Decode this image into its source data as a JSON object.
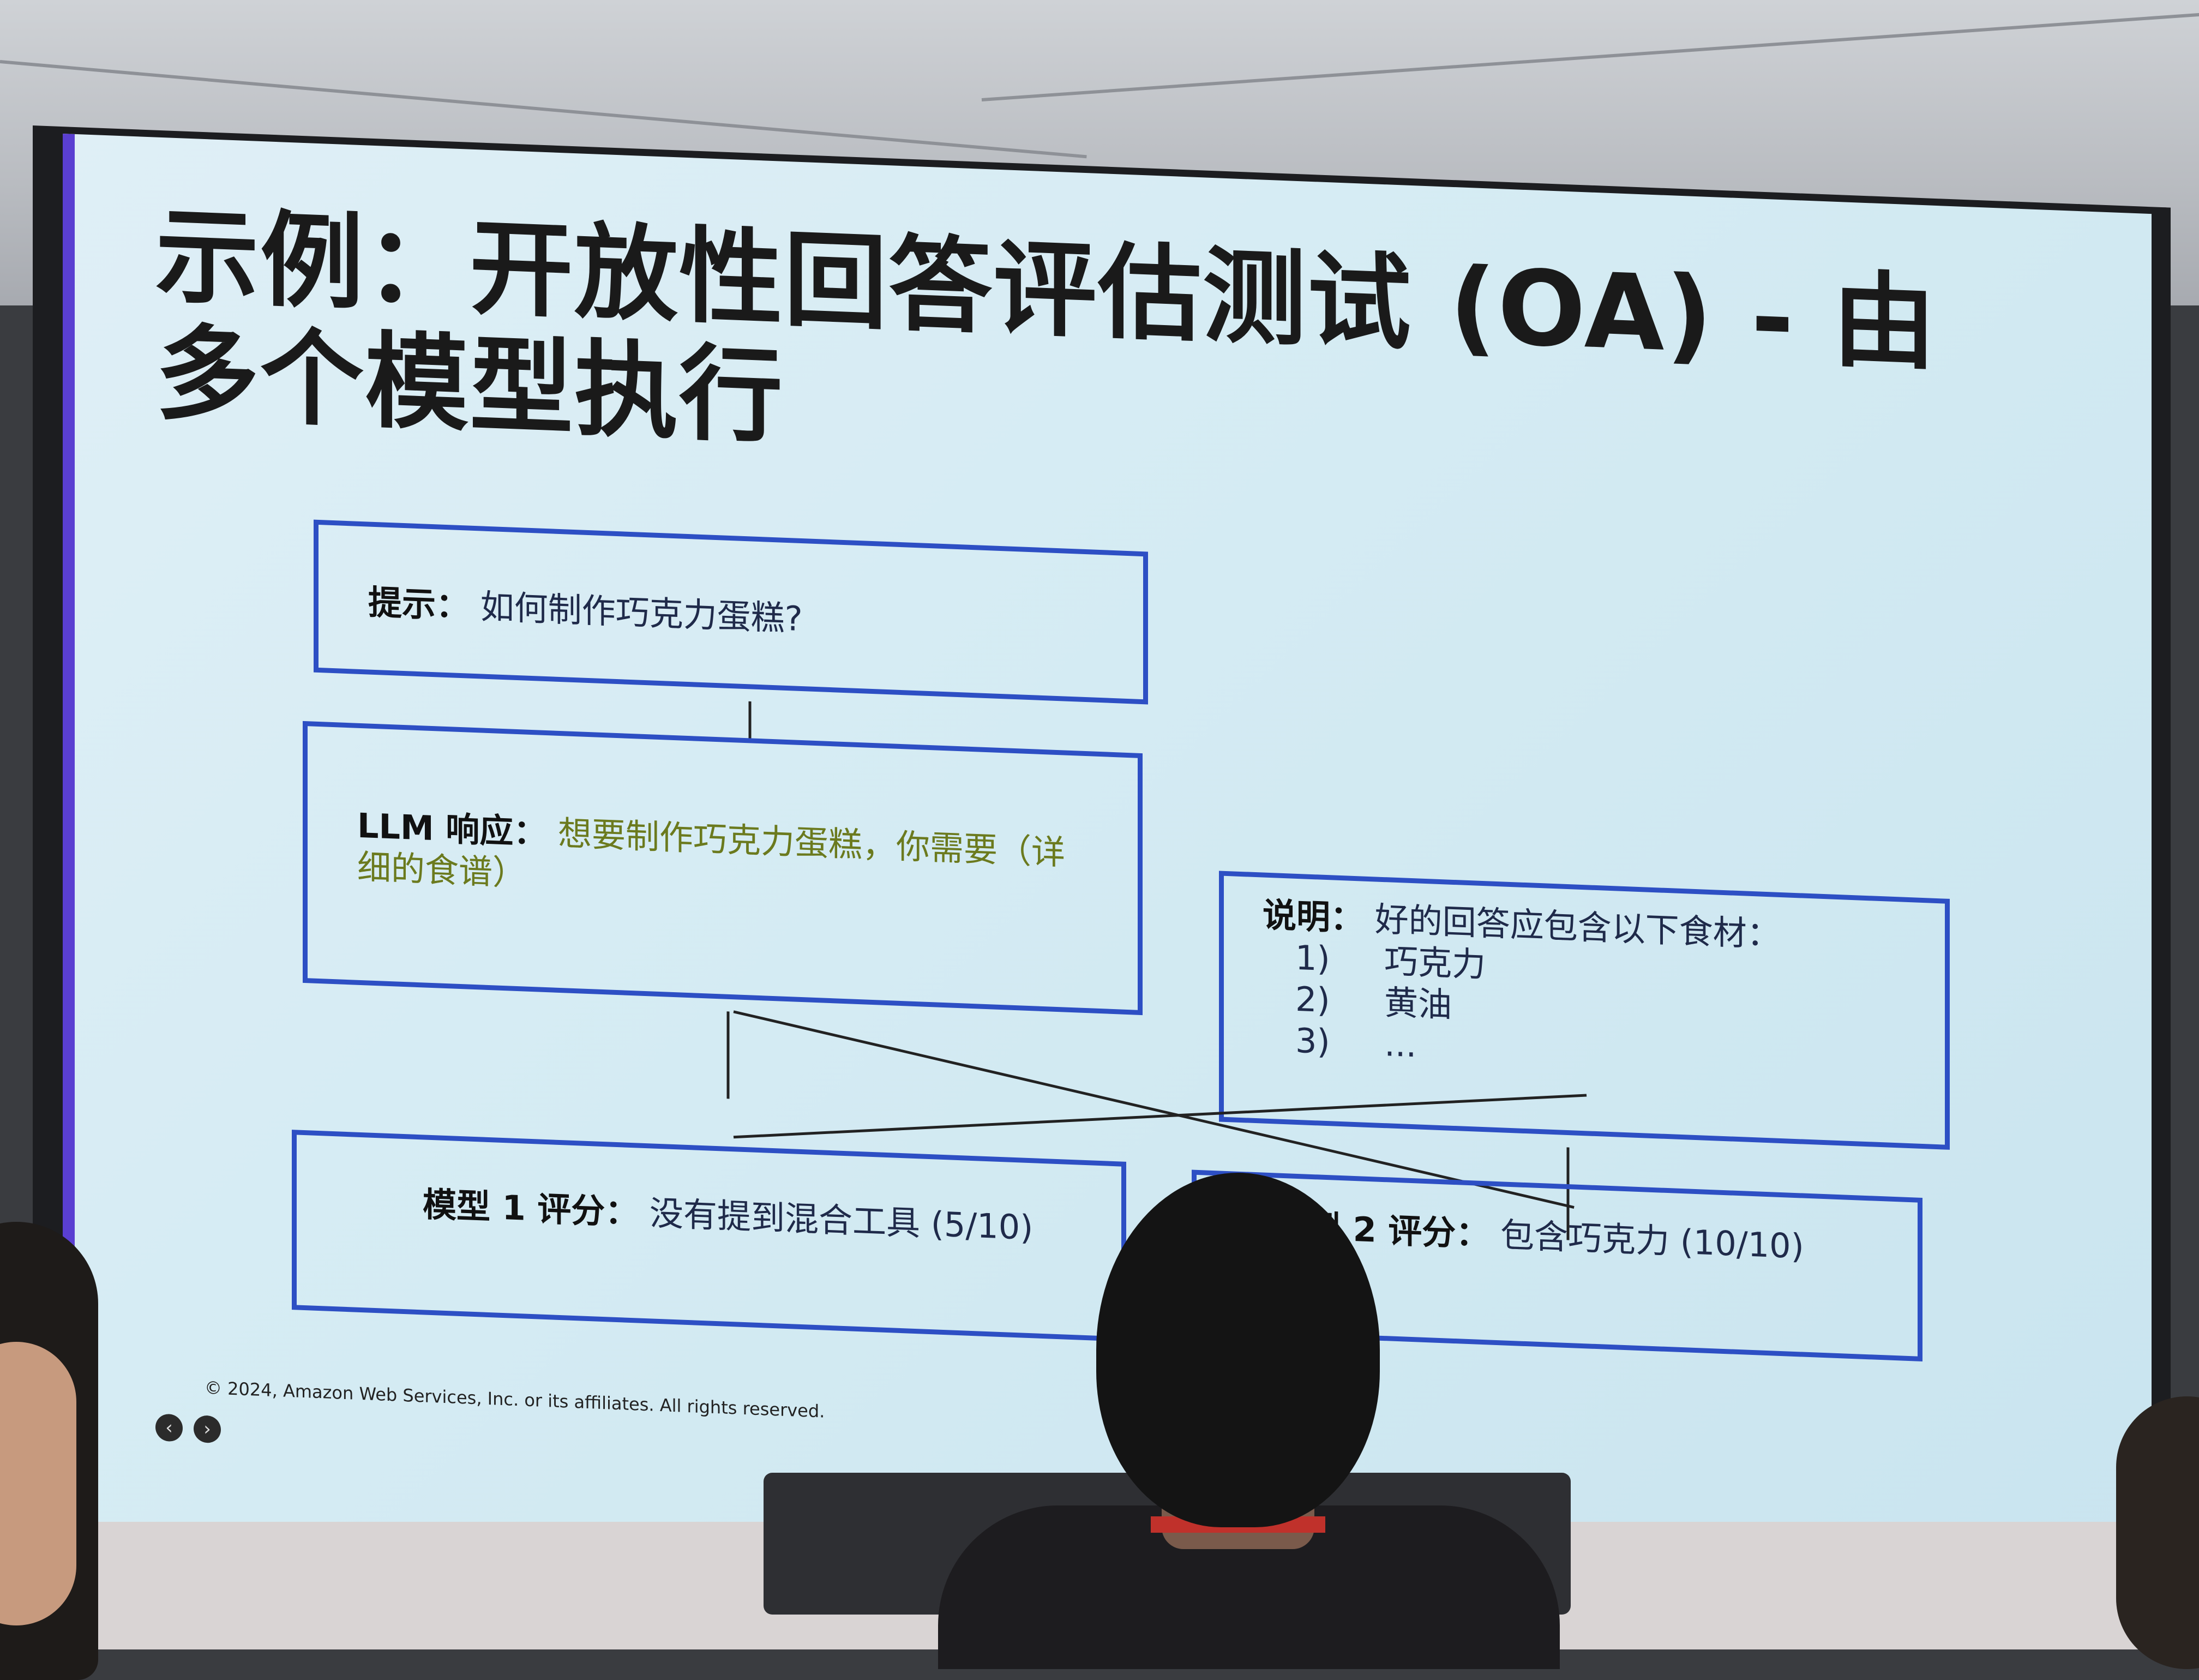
{
  "slide": {
    "title": "示例：开放性回答评估测试 (OA) - 由多个模型执行",
    "prompt_box": {
      "label": "提示：",
      "text": "如何制作巧克力蛋糕?"
    },
    "llm_box": {
      "label": "LLM 响应：",
      "text": "想要制作巧克力蛋糕，你需要（详细的食谱）"
    },
    "instructions_box": {
      "label": "说明：",
      "text": "好的回答应包含以下食材：",
      "items": [
        {
          "num": "1)",
          "text": "巧克力"
        },
        {
          "num": "2)",
          "text": "黄油"
        },
        {
          "num": "3)",
          "text": "..."
        }
      ]
    },
    "model1_box": {
      "label": "模型 1 评分：",
      "text": "没有提到混合工具 (5/10)"
    },
    "model2_box": {
      "label": "模型 2 评分：",
      "text": "包含巧克力 (10/10)"
    },
    "footer": "© 2024, Amazon Web Services, Inc. or its affiliates. All rights reserved."
  },
  "colors": {
    "box_border": "#2d4fc4",
    "slide_bg": "#d6ecf4",
    "accent": "#5a3fd1",
    "llm_text": "#6b7a1e"
  },
  "icons": [
    "chevron-left-icon",
    "arrow-right-icon"
  ]
}
